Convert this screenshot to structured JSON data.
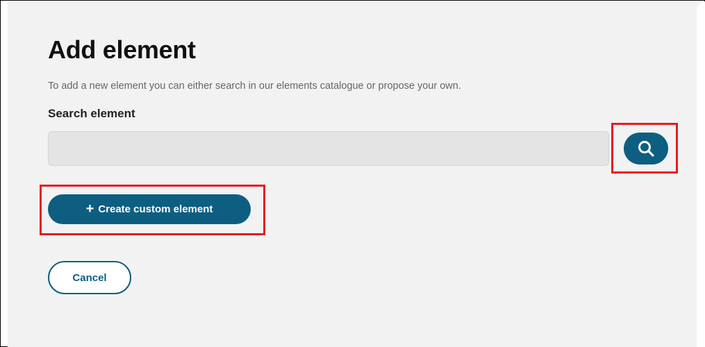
{
  "page": {
    "title": "Add element",
    "subtitle": "To add a new element you can either search in our elements catalogue or propose your own."
  },
  "search": {
    "label": "Search element",
    "value": "",
    "placeholder": "",
    "button_icon": "search-icon"
  },
  "actions": {
    "create_label": "Create custom element",
    "create_icon": "plus-icon",
    "cancel_label": "Cancel"
  },
  "colors": {
    "primary": "#0e5e82",
    "highlight": "#e51c23",
    "panel_background": "#f2f2f2",
    "input_background": "#e4e4e4"
  }
}
